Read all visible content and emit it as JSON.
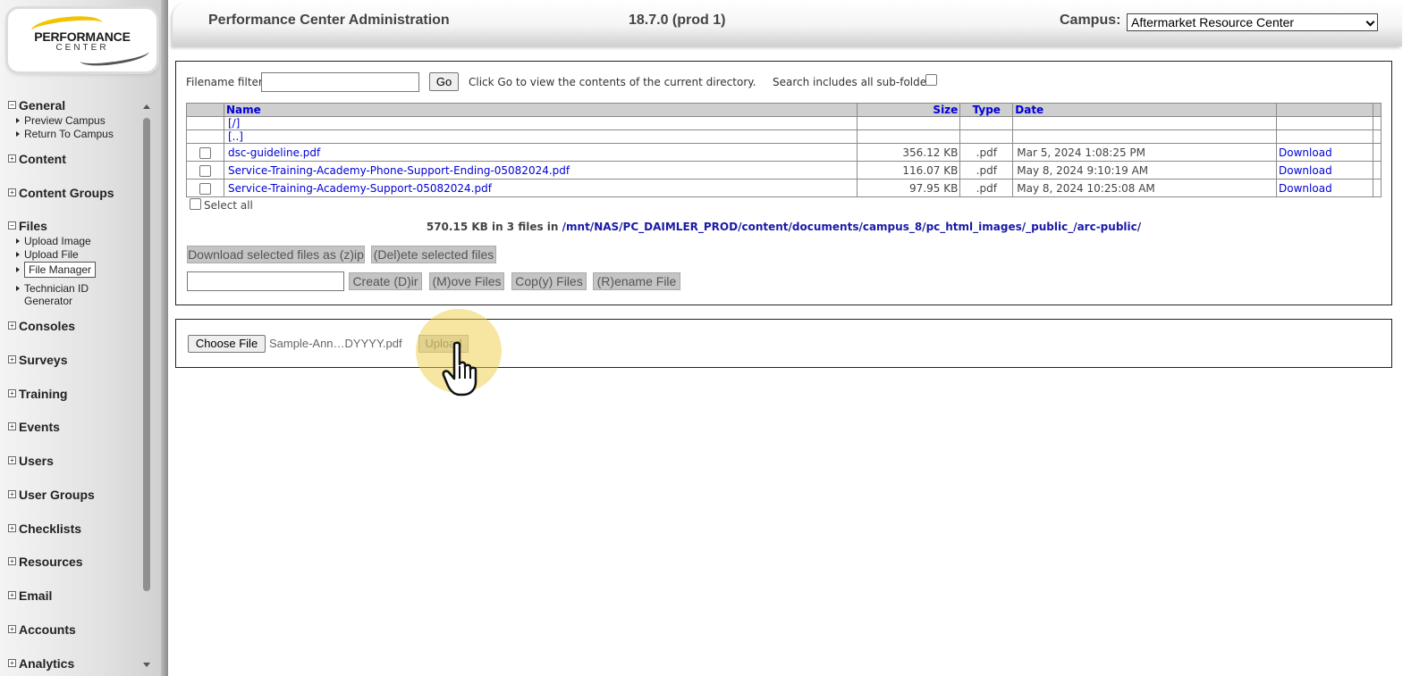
{
  "logo": {
    "line1": "PERFORMANCE",
    "line2": "CENTER"
  },
  "header": {
    "title": "Performance Center Administration",
    "version": "18.7.0 (prod 1)",
    "campus_label": "Campus:",
    "campus_selected": "Aftermarket Resource Center"
  },
  "sidebar": {
    "sections": [
      {
        "label": "General",
        "expanded": true,
        "items": [
          "Preview Campus",
          "Return To Campus"
        ]
      },
      {
        "label": "Content",
        "expanded": false
      },
      {
        "label": "Content Groups",
        "expanded": false
      },
      {
        "label": "Files",
        "expanded": true,
        "items": [
          "Upload Image",
          "Upload File",
          "File Manager",
          "Technician ID",
          "Generator"
        ]
      },
      {
        "label": "Consoles",
        "expanded": false
      },
      {
        "label": "Surveys",
        "expanded": false
      },
      {
        "label": "Training",
        "expanded": false
      },
      {
        "label": "Events",
        "expanded": false
      },
      {
        "label": "Users",
        "expanded": false
      },
      {
        "label": "User Groups",
        "expanded": false
      },
      {
        "label": "Checklists",
        "expanded": false
      },
      {
        "label": "Resources",
        "expanded": false
      },
      {
        "label": "Email",
        "expanded": false
      },
      {
        "label": "Accounts",
        "expanded": false
      },
      {
        "label": "Analytics",
        "expanded": false
      }
    ]
  },
  "file_manager": {
    "filter_label": "Filename filter:",
    "filter_value": "",
    "go_label": "Go",
    "go_hint": "Click Go to view the contents of the current directory.",
    "subfolders_label": "Search includes all sub-folders",
    "columns": {
      "name": "Name",
      "size": "Size",
      "type": "Type",
      "date": "Date"
    },
    "dirs": [
      "[/]",
      "[..]"
    ],
    "files": [
      {
        "name": "dsc-guideline.pdf",
        "size": "356.12 KB",
        "type": ".pdf",
        "date": "Mar 5, 2024 1:08:25 PM",
        "action": "Download"
      },
      {
        "name": "Service-Training-Academy-Phone-Support-Ending-05082024.pdf",
        "size": "116.07 KB",
        "type": ".pdf",
        "date": "May 8, 2024 9:10:19 AM",
        "action": "Download"
      },
      {
        "name": "Service-Training-Academy-Support-05082024.pdf",
        "size": "97.95 KB",
        "type": ".pdf",
        "date": "May 8, 2024 10:25:08 AM",
        "action": "Download"
      }
    ],
    "select_all_label": "Select all",
    "summary_prefix": "570.15 KB in 3 files in",
    "summary_path": "/mnt/NAS/PC_DAIMLER_PROD/content/documents/campus_8/pc_html_images/_public_/arc-public/",
    "btn_download_zip": "Download selected files as (z)ip",
    "btn_delete": "(Del)ete selected files",
    "dir_name_value": "",
    "btn_create_dir": "Create (D)ir",
    "btn_move": "(M)ove Files",
    "btn_copy": "Cop(y) Files",
    "btn_rename": "(R)ename File"
  },
  "upload": {
    "choose_label": "Choose File",
    "chosen_file": "Sample-Ann…DYYYY.pdf",
    "upload_label": "Upload"
  },
  "colors": {
    "link": "#0000d8",
    "halo": "#eecd46",
    "logo_yellow": "#f2c400"
  }
}
